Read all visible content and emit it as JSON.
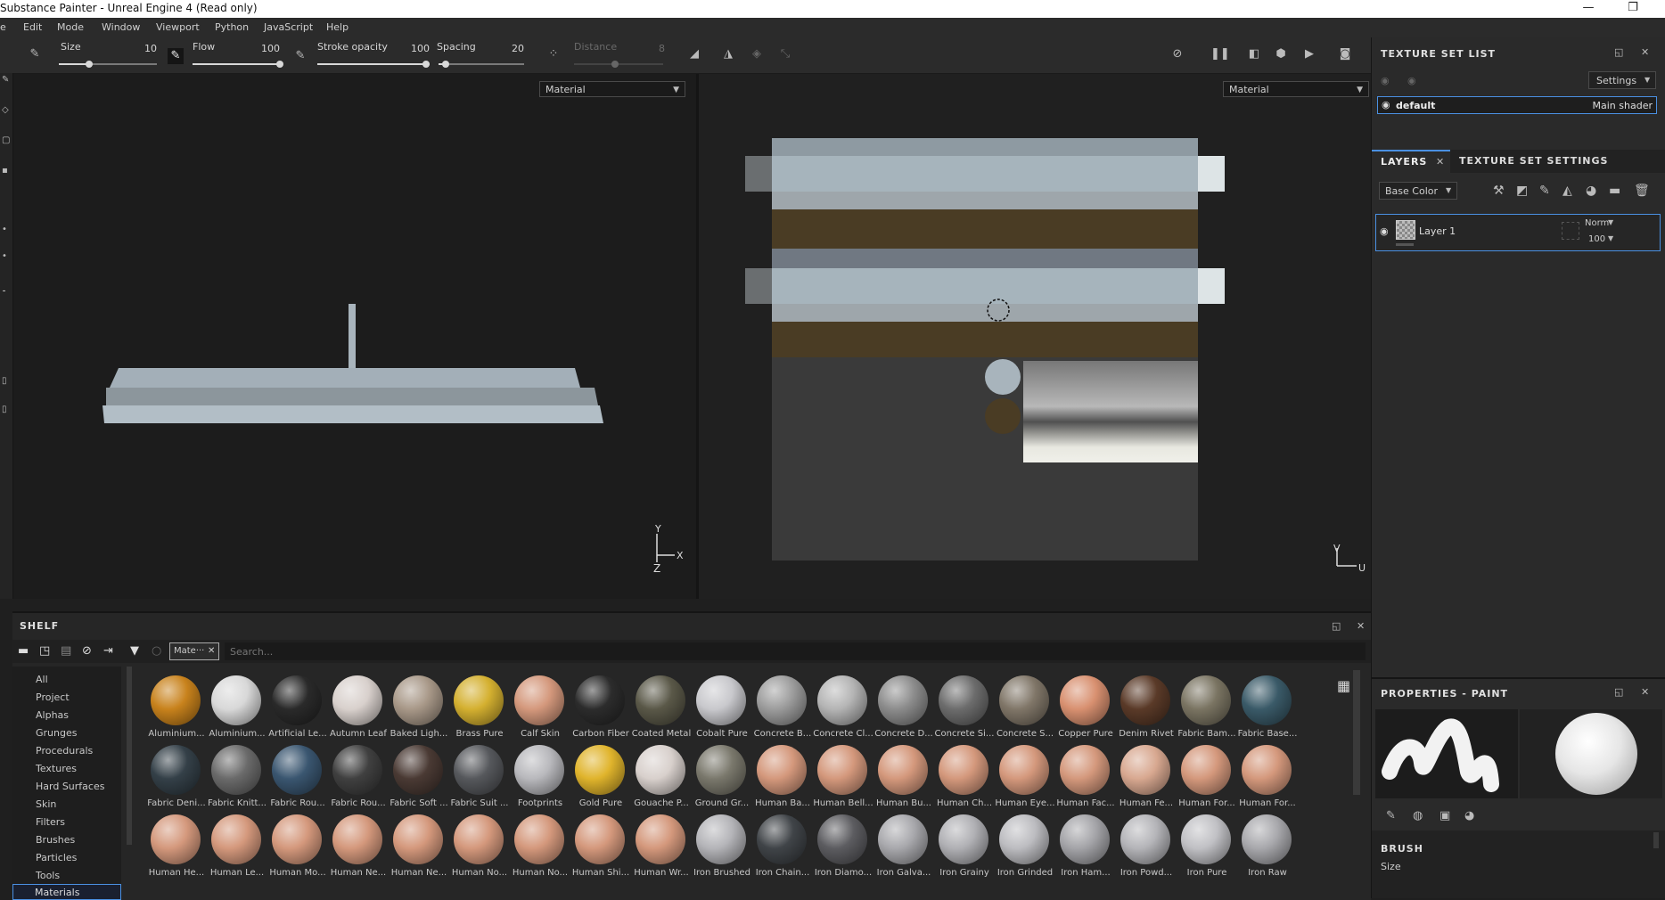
{
  "window": {
    "title": "Substance Painter - Unreal Engine 4 (Read only)",
    "minimize": "—",
    "restore": "❐"
  },
  "menu": [
    "e",
    "Edit",
    "Mode",
    "Window",
    "Viewport",
    "Python",
    "JavaScript",
    "Help"
  ],
  "toolbar": {
    "size_label": "Size",
    "size_value": "10",
    "flow_label": "Flow",
    "flow_value": "100",
    "stroke_opacity_label": "Stroke opacity",
    "stroke_opacity_value": "100",
    "spacing_label": "Spacing",
    "spacing_value": "20",
    "distance_label": "Distance",
    "distance_value": "8"
  },
  "viewport3d": {
    "select_value": "Material",
    "axis_y": "Y",
    "axis_x": "X",
    "axis_z": "Z"
  },
  "viewport2d": {
    "select_value": "Material",
    "axis_v": "V",
    "axis_u": "U"
  },
  "texture_set_list": {
    "title": "TEXTURE SET LIST",
    "settings_label": "Settings",
    "item_name": "default",
    "item_shader": "Main shader"
  },
  "layers": {
    "tab_layers": "LAYERS",
    "tab_texture_set_settings": "TEXTURE SET SETTINGS",
    "channel_select": "Base Color",
    "layer_name": "Layer 1",
    "blend_mode": "Norm",
    "opacity": "100"
  },
  "properties": {
    "title": "PROPERTIES - PAINT",
    "brush_section": "BRUSH",
    "size_label": "Size"
  },
  "shelf": {
    "title": "SHELF",
    "filter_chip": "Mate···",
    "search_placeholder": "Search...",
    "categories": [
      "All",
      "Project",
      "Alphas",
      "Grunges",
      "Procedurals",
      "Textures",
      "Hard Surfaces",
      "Skin",
      "Filters",
      "Brushes",
      "Particles",
      "Tools",
      "Materials"
    ],
    "selected_category": "Materials",
    "materials": [
      {
        "label": "Aluminium...",
        "color": "#c8821c"
      },
      {
        "label": "Aluminium...",
        "color": "#d8d8d8"
      },
      {
        "label": "Artificial Le...",
        "color": "#2a2a2a"
      },
      {
        "label": "Autumn Leaf",
        "color": "#d8d0cc"
      },
      {
        "label": "Baked Ligh...",
        "color": "#a89888"
      },
      {
        "label": "Brass Pure",
        "color": "#d4b030"
      },
      {
        "label": "Calf Skin",
        "color": "#d4987c"
      },
      {
        "label": "Carbon Fiber",
        "color": "#2c2c2c"
      },
      {
        "label": "Coated Metal",
        "color": "#5a5848"
      },
      {
        "label": "Cobalt Pure",
        "color": "#c8c8cc"
      },
      {
        "label": "Concrete B...",
        "color": "#9c9c9c"
      },
      {
        "label": "Concrete Cl...",
        "color": "#b4b4b4"
      },
      {
        "label": "Concrete D...",
        "color": "#8c8c8c"
      },
      {
        "label": "Concrete Si...",
        "color": "#6c6c6c"
      },
      {
        "label": "Concrete S...",
        "color": "#807668"
      },
      {
        "label": "Copper Pure",
        "color": "#d89070"
      },
      {
        "label": "Denim Rivet",
        "color": "#5a3a28"
      },
      {
        "label": "Fabric Bam...",
        "color": "#7a7462"
      },
      {
        "label": "Fabric Base...",
        "color": "#3a5a68"
      },
      {
        "label": "Fabric Deni...",
        "color": "#344048"
      },
      {
        "label": "Fabric Knitt...",
        "color": "#6a6a6a"
      },
      {
        "label": "Fabric Rou...",
        "color": "#3a5670"
      },
      {
        "label": "Fabric Rou...",
        "color": "#404040"
      },
      {
        "label": "Fabric Soft ...",
        "color": "#4a3a34"
      },
      {
        "label": "Fabric Suit ...",
        "color": "#56585c"
      },
      {
        "label": "Footprints",
        "color": "#b8b8bc"
      },
      {
        "label": "Gold Pure",
        "color": "#e0b42c"
      },
      {
        "label": "Gouache P...",
        "color": "#d8d0cc"
      },
      {
        "label": "Ground Gr...",
        "color": "#7a786c"
      },
      {
        "label": "Human Ba...",
        "color": "#d4987c"
      },
      {
        "label": "Human Bell...",
        "color": "#d4987c"
      },
      {
        "label": "Human Bu...",
        "color": "#d4987c"
      },
      {
        "label": "Human Ch...",
        "color": "#d4987c"
      },
      {
        "label": "Human Eye...",
        "color": "#d4987c"
      },
      {
        "label": "Human Fac...",
        "color": "#d4987c"
      },
      {
        "label": "Human Fe...",
        "color": "#d8a890"
      },
      {
        "label": "Human For...",
        "color": "#d4987c"
      },
      {
        "label": "Human For...",
        "color": "#d4987c"
      },
      {
        "label": "Human He...",
        "color": "#d4987c"
      },
      {
        "label": "Human Le...",
        "color": "#d4987c"
      },
      {
        "label": "Human Mo...",
        "color": "#d4987c"
      },
      {
        "label": "Human Ne...",
        "color": "#d4987c"
      },
      {
        "label": "Human Ne...",
        "color": "#d4987c"
      },
      {
        "label": "Human No...",
        "color": "#d4987c"
      },
      {
        "label": "Human No...",
        "color": "#d4987c"
      },
      {
        "label": "Human Shi...",
        "color": "#d4987c"
      },
      {
        "label": "Human Wr...",
        "color": "#d4987c"
      },
      {
        "label": "Iron Brushed",
        "color": "#b4b4b8"
      },
      {
        "label": "Iron Chain...",
        "color": "#404448"
      },
      {
        "label": "Iron Diamo...",
        "color": "#5c5c60"
      },
      {
        "label": "Iron Galva...",
        "color": "#a8a8ac"
      },
      {
        "label": "Iron Grainy",
        "color": "#b0b0b4"
      },
      {
        "label": "Iron Grinded",
        "color": "#bcbcc0"
      },
      {
        "label": "Iron Ham...",
        "color": "#a4a4a8"
      },
      {
        "label": "Iron Powd...",
        "color": "#b4b4b8"
      },
      {
        "label": "Iron Pure",
        "color": "#c0c0c4"
      },
      {
        "label": "Iron Raw",
        "color": "#a8a8ac"
      }
    ]
  },
  "colors": {
    "accent": "#4a90e2",
    "panel_bg": "#2a2a2a",
    "viewport_bg": "#1c1c1c"
  }
}
